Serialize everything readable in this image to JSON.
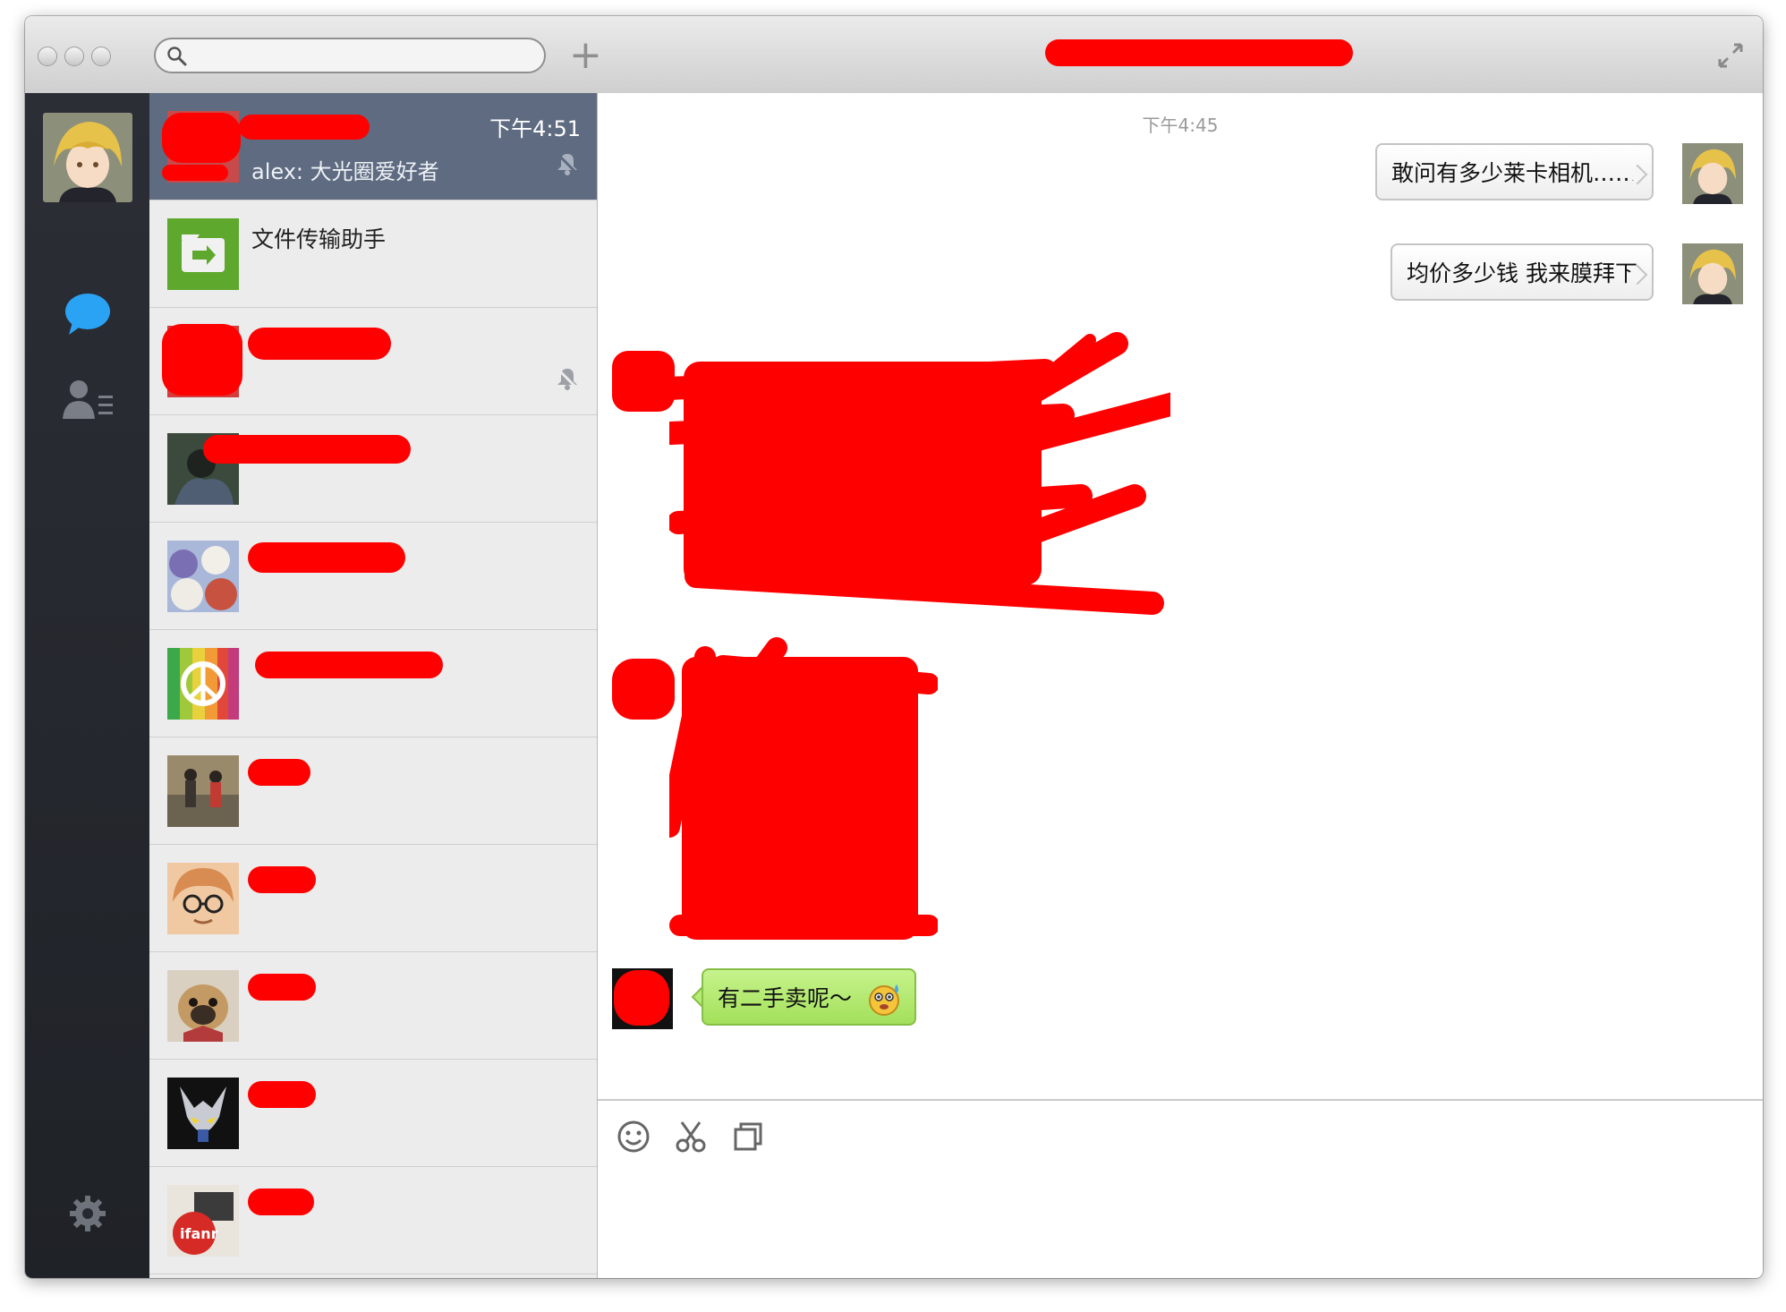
{
  "window": {
    "chat_title": "",
    "search": {
      "value": "",
      "placeholder": ""
    }
  },
  "rail": {
    "items": [
      {
        "icon": "profile-avatar"
      },
      {
        "icon": "chat-bubble-icon",
        "active": true
      },
      {
        "icon": "contacts-icon"
      },
      {
        "icon": "gear-icon"
      }
    ]
  },
  "conversations": [
    {
      "name": "",
      "preview": "alex: 大光圈爱好者",
      "time": "下午4:51",
      "muted": true,
      "active": true
    },
    {
      "name": "文件传输助手",
      "preview": "",
      "time": ""
    },
    {
      "name": "",
      "preview": "",
      "muted": true
    },
    {
      "name": "",
      "preview": ""
    },
    {
      "name": "",
      "preview": ""
    },
    {
      "name": "",
      "preview": ""
    },
    {
      "name": "",
      "preview": ""
    },
    {
      "name": "",
      "preview": ""
    },
    {
      "name": "",
      "preview": ""
    },
    {
      "name": "",
      "preview": ""
    },
    {
      "name": "",
      "preview": ""
    }
  ],
  "messages": {
    "timestamp_top": "下午4:45",
    "out": [
      {
        "text": "敢问有多少莱卡相机……"
      },
      {
        "text": "均价多少钱 我来膜拜下"
      }
    ],
    "in_last": {
      "text": "有二手卖呢～",
      "emoji": "drooling-face-emoji"
    }
  },
  "composer": {
    "tools": [
      "smiley-icon",
      "scissors-icon",
      "screenshot-window-icon"
    ],
    "value": ""
  },
  "colors": {
    "sidebar_dark": "#24272d",
    "list_bg": "#ececec",
    "active_row": "#5e6b80",
    "bubble_in": "#b4ea73",
    "redaction": "#ff0000",
    "chat_accent": "#2aa3f5"
  }
}
